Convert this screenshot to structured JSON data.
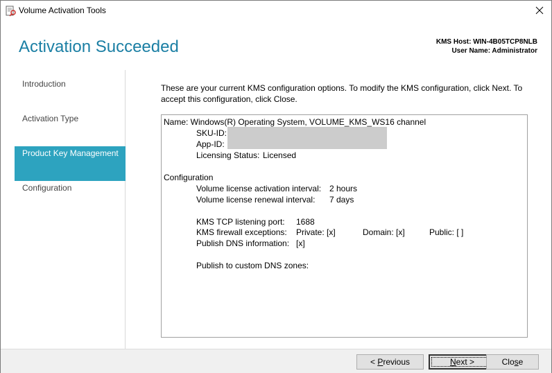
{
  "window": {
    "title": "Volume Activation Tools"
  },
  "header": {
    "page_title": "Activation Succeeded",
    "kms_host_label": "KMS Host: WIN-4B05TCP8NLB",
    "user_name_label": "User Name: Administrator"
  },
  "nav": {
    "items": [
      {
        "label": "Introduction",
        "active": false
      },
      {
        "label": "Activation Type",
        "active": false
      },
      {
        "label": "Product Key Management",
        "active": true
      },
      {
        "label": "Configuration",
        "active": false
      }
    ]
  },
  "main": {
    "intro_text": "These are your current KMS configuration options. To modify the KMS configuration, click Next. To accept this configuration, click Close.",
    "details": {
      "name_line": "Name: Windows(R) Operating System, VOLUME_KMS_WS16 channel",
      "sku_id_label": "SKU-ID:",
      "app_id_label": "App-ID:",
      "licensing_status_label": "Licensing Status:",
      "licensing_status_value": "Licensed",
      "configuration_heading": "Configuration",
      "activation_interval_label": "Volume license activation interval:",
      "activation_interval_value": "2 hours",
      "renewal_interval_label": "Volume license renewal interval:",
      "renewal_interval_value": "7 days",
      "tcp_port_label": "KMS TCP listening port:",
      "tcp_port_value": "1688",
      "firewall_label": "KMS firewall exceptions:",
      "firewall_private": "Private: [x]",
      "firewall_domain": "Domain: [x]",
      "firewall_public": "Public: [ ]",
      "publish_dns_label": "Publish DNS information:",
      "publish_dns_value": "[x]",
      "custom_dns_label": "Publish to custom DNS zones:"
    }
  },
  "footer": {
    "previous_prefix": "< ",
    "previous_key": "P",
    "previous_rest": "revious",
    "next_key": "N",
    "next_rest": "ext >",
    "close_prefix": "Clo",
    "close_key": "s",
    "close_rest": "e"
  },
  "colors": {
    "accent": "#2da3bf",
    "title": "#1b7fa4"
  }
}
